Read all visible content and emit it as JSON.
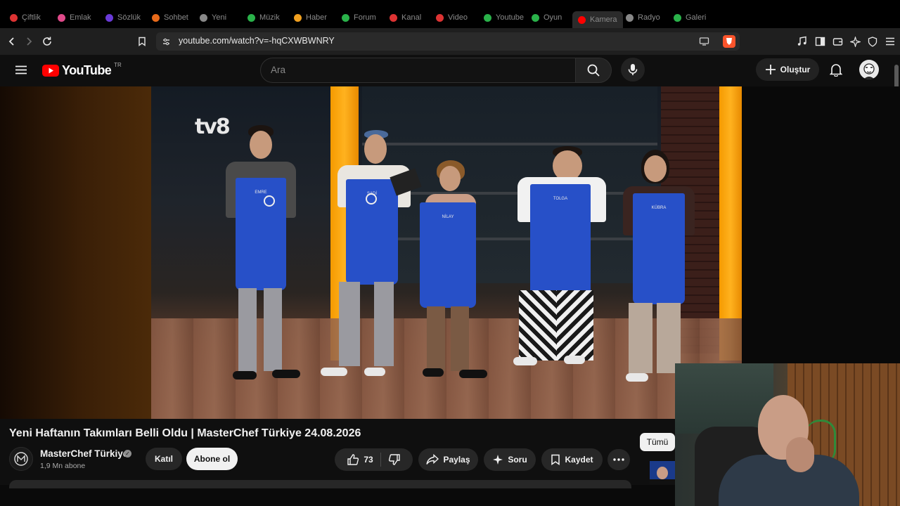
{
  "browser": {
    "tabs": [
      "Çiftlik",
      "Emlak",
      "Sözlük",
      "Sohbet",
      "Yeni",
      "Müzik",
      "Haber",
      "Forum",
      "Kanal",
      "Video",
      "Youtube",
      "Oyun",
      "Kamera",
      "Radyo",
      "Galeri"
    ],
    "url": "youtube.com/watch?v=-hqCXWBWNRY"
  },
  "masthead": {
    "logo_text": "YouTube",
    "region": "TR",
    "search_placeholder": "Ara",
    "create_label": "Oluştur"
  },
  "video": {
    "title": "Yeni Haftanın Takımları Belli Oldu | MasterChef Türkiye 24.08.2026",
    "channel_watermark": "tv8",
    "contestants": [
      "EMRE",
      "SADİ",
      "NİLAY",
      "TOLGA",
      "KÜBRA"
    ]
  },
  "channel": {
    "name": "MasterChef Türkiye",
    "subscribers": "1,9 Mn abone",
    "join_label": "Katıl",
    "subscribe_label": "Abone ol"
  },
  "actions": {
    "like_count": "73",
    "share_label": "Paylaş",
    "ask_label": "Soru",
    "save_label": "Kaydet"
  },
  "sidebar": {
    "filter_label": "Tümü"
  },
  "colors": {
    "brand_red": "#ff0000",
    "apron_blue": "#2750c8",
    "pillar_orange": "#ffb21f"
  }
}
